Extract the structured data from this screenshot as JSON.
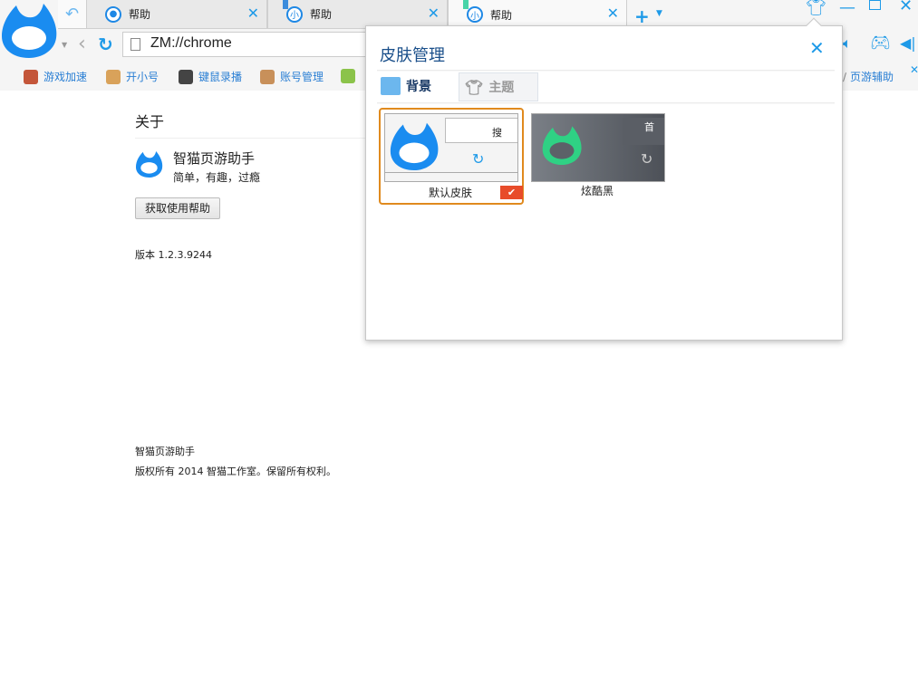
{
  "tabs": [
    {
      "label": "帮助",
      "icon": "zhimao-icon"
    },
    {
      "label": "帮助",
      "icon": "xiao-icon"
    },
    {
      "label": "帮助",
      "icon": "xiao-icon",
      "active": true
    }
  ],
  "tab_icon_char": "小",
  "address": "ZM://chrome",
  "bookmarks": [
    {
      "label": "游戏加速"
    },
    {
      "label": "开小号"
    },
    {
      "label": "键鼠录播"
    },
    {
      "label": "账号管理"
    },
    {
      "label": "页游辅助"
    }
  ],
  "page": {
    "heading": "关于",
    "app_name": "智猫页游助手",
    "slogan": "简单，有趣，过瘾",
    "help_button": "获取使用帮助",
    "version": "版本 1.2.3.9244",
    "footer_name": "智猫页游助手",
    "copyright": "版权所有 2014 智猫工作室。保留所有权利。"
  },
  "popup": {
    "title": "皮肤管理",
    "tabs": [
      {
        "label": "背景"
      },
      {
        "label": "主题"
      }
    ],
    "skins": [
      {
        "label": "默认皮肤",
        "selected": true
      },
      {
        "label": "炫酷黑"
      }
    ],
    "preview_text": "搜",
    "preview_text2": "首"
  },
  "colors": {
    "accent": "#1e9ae8",
    "selected_border": "#e08a1e",
    "check": "#e84c2a"
  }
}
